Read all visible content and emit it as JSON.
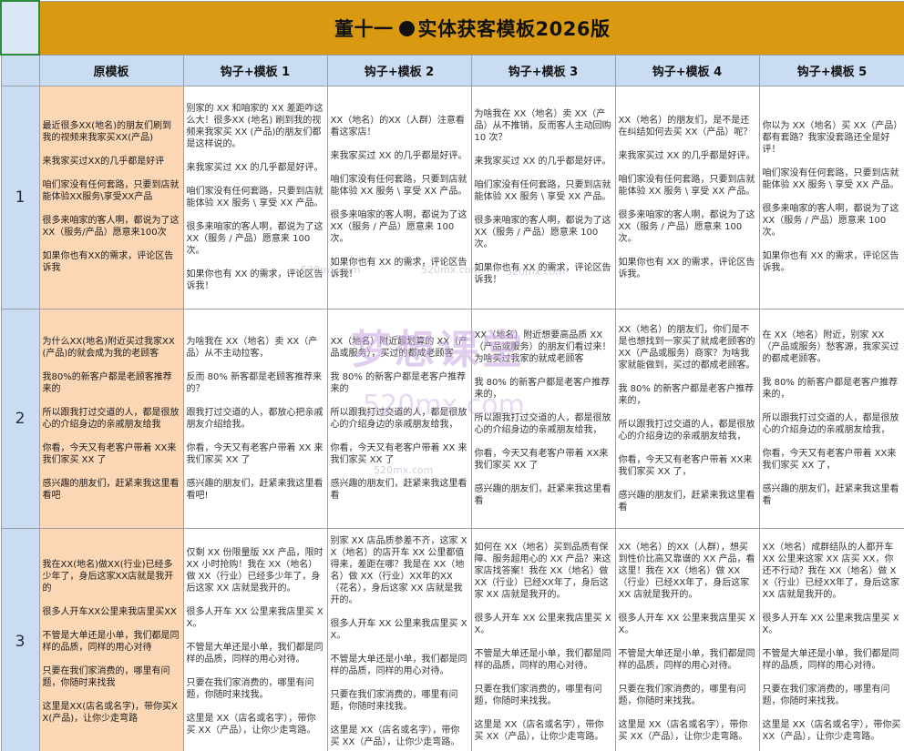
{
  "title": {
    "author": "董十一",
    "subject": "实体获客模板2026版"
  },
  "headers": [
    "原模板",
    "钩子+模板 1",
    "钩子+模板 2",
    "钩子+模板 3",
    "钩子+模板 4",
    "钩子+模板 5"
  ],
  "rows": [
    {
      "num": "1",
      "cells": [
        [
          "最近很多XX(地名)的朋友们刷到我的视频来我家买XX(产品)",
          "来我家买过XX的几乎都是好评",
          "咱们家没有任何套路，只要到店就能体验XX服务\\享受XX产品",
          "很多来咱家的客人啊，都说为了这XX（服务/产品）愿意来100次",
          "如果你也有XX的需求，评论区告诉我"
        ],
        [
          "别家的 XX 和咱家的 XX 差距咋这么大！很多XX (地名) 刷到我的视频来我家买 XX (产品)的朋友们都是这样说的。",
          "来我家买过 XX 的几乎都是好评。",
          "咱们家没有任何套路，只要到店就能体验 XX 服务 \\ 享受 XX 产品。",
          "很多来咱家的客人啊，都说为了这 XX（服务 / 产品）愿意来 100次。",
          "如果你也有 XX 的需求，评论区告诉我！"
        ],
        [
          "XX（地名）的XX（人群）注意看看这家店！",
          "来我家买过 XX 的几乎都是好评。",
          "咱们家没有任何套路，只要到店就能体验 XX 服务 \\ 享受 XX 产品。",
          "很多来咱家的客人啊，都说为了这 XX（服务 / 产品）愿意来 100次。",
          "如果你也有 XX 的需求，评论区告诉我！"
        ],
        [
          "为啥我在 XX（地名）卖 XX（产品）从不推销，反而客人主动回购 10 次？",
          "来我家买过 XX 的几乎都是好评。",
          "咱们家没有任何套路，只要到店就能体验 XX 服务 \\ 享受 XX 产品。",
          "很多来咱家的客人啊，都说为了这 XX（服务 / 产品）愿意来 100次。",
          "如果你也有 XX 的需求，评论区告诉我！"
        ],
        [
          "XX（地名）的朋友们，是不是还在纠结如何去买 XX（产品）呢？",
          "来我家买过 XX 的几乎都是好评。",
          "咱们家没有任何套路，只要到店就能体验 XX 服务 \\ 享受 XX 产品。",
          "很多来咱家的客人啊，都说为了这 XX（服务 / 产品）愿意来 100次。",
          "如果你也有 XX 的需求，评论区告诉我。"
        ],
        [
          "你以为 XX（地名）买 XX（产品）都有套路？我家没套路还全是好评！",
          "咱们家没有任何套路，只要到店就能体验 XX 服务 \\ 享受 XX 产品。",
          "很多来咱家的客人啊，都说为了这 XX（服务 / 产品）愿意来 100次。",
          "如果你也有 XX 的需求，评论区告诉我。"
        ]
      ]
    },
    {
      "num": "2",
      "cells": [
        [
          "为什么XX(地名)附近买过我家XX(产品)的就会成为我的老顾客",
          "我80%的新客户都是老顾客推荐来的",
          "所以跟我打过交道的人，都是很放心的介绍身边的亲戚朋友给我",
          "你看，今天又有老客户带着 XX来我们家买 XX 了",
          "感兴趣的朋友们，赶紧来我这里看看吧"
        ],
        [
          "为啥我在 XX（地名）卖 XX（产品）从不主动拉客，",
          "反而 80% 新客都是老顾客推荐来的？",
          "跟我打过交道的人，都放心把亲戚朋友介绍给我。",
          "你看，今天又有老客户带着 XX 来我们家买 XX 了",
          "感兴趣的朋友们，赶紧来我这里看看吧!"
        ],
        [
          "XX（地名）附近超划算的 XX（产品或服务），买过的都成老顾客",
          "我 80% 的新客户都是老客户推荐来的",
          "所以跟我打过交道的人，都是很放心的介绍身边的亲戚朋友给我，",
          "你看，今天又有老客户带着 XX 来我们家买 XX 了",
          "感兴趣的朋友们，赶紧来我这里看看"
        ],
        [
          "XX（地名）附近想要高品质 XX（产品或服务）的朋友们看过来！为啥买过我家的就成老顾客",
          "我 80% 的新客户都是老客户推荐来的，",
          "所以跟我打过交道的人，都是很放心的介绍身边的亲戚朋友给我，",
          "你看，今天又有老客户带着 XX来我们家买 XX 了",
          "感兴趣的朋友们，赶紧来我这里看看"
        ],
        [
          "XX（地名）的朋友们，你们是不是也想找到一家买了就成老顾客的 XX（产品或服务）商家？为啥我家就能做到，买过的都成老顾客。",
          "我 80% 的新客户都是老客户推荐来的，",
          "所以跟我打过交道的人，都是很放心的介绍身边的亲戚朋友给我，",
          "你看，今天又有老客户带着 XX来我们家买 XX 了，",
          "感兴趣的朋友们，赶紧来我这里看看"
        ],
        [
          "在 XX（地名）附近，别家 XX（产品或服务）愁客源，我家买过的都成老顾客。",
          "我 80% 的新客户都是老客户推荐来的，",
          "所以跟我打过交道的人，都是很放心的介绍身边的亲戚朋友给我，",
          "你看，今天又有老客户带着 XX来我们家买 XX 了，",
          "感兴趣的朋友们，赶紧来我这里看看"
        ]
      ]
    },
    {
      "num": "3",
      "cells": [
        [
          "我在XX(地名)做XX(行业)已经多少年了，身后这家XX店就是我开的",
          "很多人开车XX公里来我店里买XX",
          "不管是大单还是小单，我们都是同样的品质，同样的用心对待",
          "只要在我们家消费的，哪里有问题，你随时来找我",
          "这里是XX(店名或名字)，带你买XX(产品)，让你少走弯路"
        ],
        [
          "仅剩 XX 份限量版 XX 产品，限时 XX 小时抢购！我在 XX（地名）做 XX（行业）已经多少年了，身后这家 XX 店就是我开的。",
          "很多人开车 XX 公里来我店里买 XX。",
          "不管是大单还是小单，我们都是同样的品质，同样的用心对待。",
          "只要在我们家消费的，哪里有问题，你随时来找我。",
          "这里是 XX（店名或名字），带你买 XX（产品），让你少走弯路。"
        ],
        [
          "别家 XX 店品质参差不齐，这家 XX（地名）的店开车 XX 公里都值得来，差距在哪？我是在 XX（地名）做 XX（行业）XX年的XX（花名），身后这家 XX 店就是我开的。",
          "很多人开车 XX 公里来我店里买 XX。",
          "不管是大单还是小单，我们都是同样的品质，同样的用心对待。",
          "只要在我们家消费的，哪里有问题，你随时来找我。",
          "这里是 XX（店名或名字），带你买 XX（产品），让你少走弯路。"
        ],
        [
          "如何在 XX（地名）买到品质有保障、服务超用心的 XX 产品？来这家店找答案！我在 XX（地名）做 XX（行业）已经XX年了，身后这家 XX 店就是我开的。",
          "很多人开车 XX 公里来我店里买 XX。",
          "不管是大单还是小单，我们都是同样的品质，同样的用心对待。",
          "只要在我们家消费的，哪里有问题，你随时来找我。",
          "这里是 XX（店名或名字），带你买 XX（产品），让你少走弯路。"
        ],
        [
          "XX（地名）的XX（人群），想买到性价比高又靠谱的 XX 产品，看这里！我在 XX（地名）做 XX（行业）已经XX年了，身后这家 XX 店就是我开的。",
          "很多人开车 XX 公里来我店里买 XX。",
          "不管是大单还是小单，我们都是同样的品质，同样的用心对待。",
          "只要在我们家消费的，哪里有问题，你随时来找我。",
          "这里是 XX（店名或名字），带你买 XX（产品），让你少走弯路。"
        ],
        [
          "XX（地名）成群结队的人都开车 XX 公里来这家 XX 店买 XX，你还不行动？我在 XX（地名）做 XX（行业）已经XX年了，身后这家 XX 店就是我开的。",
          "很多人开车 XX 公里来我店里买 XX。",
          "不管是大单还是小单，我们都是同样的品质，同样的用心对待。",
          "只要在我们家消费的，哪里有问题，你随时来找我。",
          "这里是 XX（店名或名字），带你买 XX（产品），让你少走弯路。"
        ]
      ]
    }
  ],
  "watermark": {
    "brand": "梦想课堂",
    "url": "520mx.com"
  }
}
